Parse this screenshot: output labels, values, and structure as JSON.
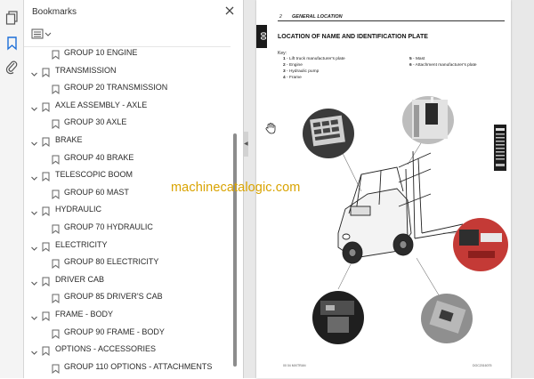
{
  "rail": {
    "icons": [
      "pages-thumbnail-icon",
      "bookmark-icon",
      "attachment-paperclip-icon"
    ]
  },
  "panel": {
    "title": "Bookmarks",
    "close_icon": "close-icon",
    "options_icon": "bookmark-options-icon"
  },
  "bookmarks": [
    {
      "label": "GROUP 10 ENGINE",
      "level": 1
    },
    {
      "label": "TRANSMISSION",
      "level": 0
    },
    {
      "label": "GROUP 20 TRANSMISSION",
      "level": 1
    },
    {
      "label": "AXLE ASSEMBLY - AXLE",
      "level": 0
    },
    {
      "label": "GROUP 30  AXLE",
      "level": 1
    },
    {
      "label": "BRAKE",
      "level": 0
    },
    {
      "label": "GROUP 40 BRAKE",
      "level": 1
    },
    {
      "label": "TELESCOPIC BOOM",
      "level": 0
    },
    {
      "label": "GROUP 60 MAST",
      "level": 1
    },
    {
      "label": "HYDRAULIC",
      "level": 0
    },
    {
      "label": "GROUP 70  HYDRAULIC",
      "level": 1
    },
    {
      "label": "ELECTRICITY",
      "level": 0
    },
    {
      "label": "GROUP 80 ELECTRICITY",
      "level": 1
    },
    {
      "label": "DRIVER CAB",
      "level": 0
    },
    {
      "label": "GROUP 85 DRIVER'S CAB",
      "level": 1
    },
    {
      "label": "FRAME - BODY",
      "level": 0
    },
    {
      "label": "GROUP 90 FRAME - BODY",
      "level": 1
    },
    {
      "label": "OPTIONS - ACCESSORIES",
      "level": 0
    },
    {
      "label": "GROUP 110  OPTIONS - ATTACHMENTS",
      "level": 1
    }
  ],
  "document": {
    "page_number": "2",
    "header": "GENERAL LOCATION",
    "side_tab": "00",
    "title": "LOCATION OF NAME AND IDENTIFICATION PLATE",
    "key_label": "Key:",
    "key_items": [
      {
        "num": "1",
        "text": "Lift truck manufacturer's plate"
      },
      {
        "num": "2",
        "text": "Engine"
      },
      {
        "num": "3",
        "text": "Hydraulic pump"
      },
      {
        "num": "4",
        "text": "Frame"
      },
      {
        "num": "5",
        "text": "Mast"
      },
      {
        "num": "6",
        "text": "Attachment manufacturer's plate"
      }
    ],
    "footer_left": "00 04 MIXTRAN",
    "footer_right": "DOC2016075"
  },
  "watermark": "machinecatalogic.com",
  "colors": {
    "watermark": "#d9a300",
    "rail_bg": "#f4f4f4",
    "doc_bg": "#e8e8e8"
  }
}
